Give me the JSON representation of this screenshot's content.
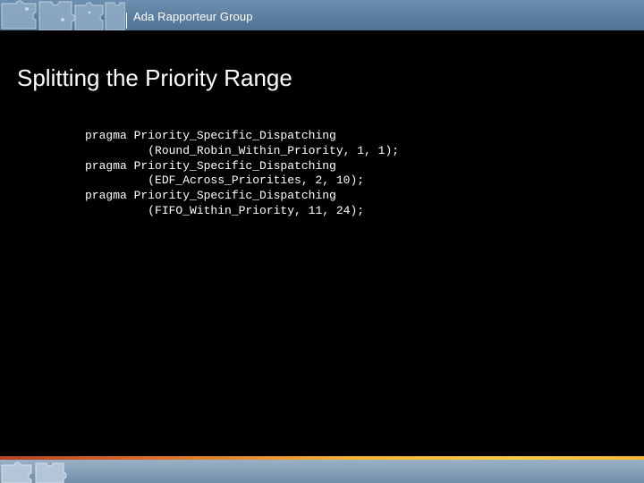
{
  "header": {
    "org_name": "Ada Rapporteur Group"
  },
  "slide": {
    "title": "Splitting the Priority Range",
    "code_lines": [
      "pragma Priority_Specific_Dispatching",
      "         (Round_Robin_Within_Priority, 1, 1);",
      "pragma Priority_Specific_Dispatching",
      "         (EDF_Across_Priorities, 2, 10);",
      "pragma Priority_Specific_Dispatching",
      "         (FIFO_Within_Priority, 11, 24);"
    ]
  },
  "colors": {
    "background": "#000000",
    "header_bar": "#5a7d9e",
    "text": "#ffffff",
    "footer_stripe": "#f2b33a"
  },
  "icons": {
    "header_graphic": "puzzle-pieces-icon",
    "footer_graphic": "puzzle-pieces-icon"
  }
}
